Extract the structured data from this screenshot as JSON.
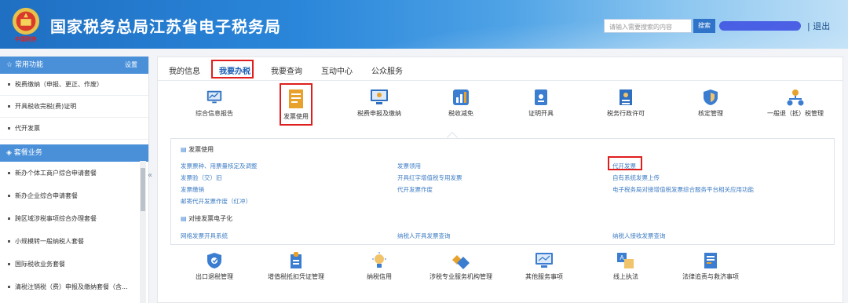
{
  "header": {
    "title": "国家税务总局江苏省电子税务局",
    "emblem_caption": "中国税务",
    "search_placeholder": "请输入需要搜索的内容",
    "search_button": "搜索",
    "logout": "| 退出"
  },
  "sidebar": {
    "common_title": "常用功能",
    "settings": "设置",
    "common_items": [
      "税费缴纳（申报、更正、作废）",
      "开具税收完税(费)证明",
      "代开发票"
    ],
    "package_title": "套餐业务",
    "package_items": [
      "新办个体工商户综合申请套餐",
      "新办企业综合申请套餐",
      "跨区域涉税事项综合办理套餐",
      "小规模转一般纳税人套餐",
      "国际税收业务套餐",
      "清税注销税（费）申报及缴纳套餐（含..."
    ],
    "collapse_icon": "«"
  },
  "tabs": [
    "我的信息",
    "我要办税",
    "我要查询",
    "互动中心",
    "公众服务"
  ],
  "top_icons": [
    {
      "label": "综合信息报告",
      "icon": "monitor-chart-icon"
    },
    {
      "label": "发票使用",
      "icon": "invoice-doc-icon"
    },
    {
      "label": "税费申报及缴纳",
      "icon": "monitor-icon"
    },
    {
      "label": "税收减免",
      "icon": "bar-chart-icon"
    },
    {
      "label": "证明开具",
      "icon": "certificate-icon"
    },
    {
      "label": "税务行政许可",
      "icon": "license-icon"
    },
    {
      "label": "核定管理",
      "icon": "shield-icon"
    },
    {
      "label": "一般退（抵）税管理",
      "icon": "org-chart-icon"
    }
  ],
  "invoice_section": {
    "title": "发票使用",
    "col1": [
      "发票票种、用票量核定及调整",
      "发票验（交）旧",
      "发票缴销",
      "邮寄代开发票作废（红冲）"
    ],
    "col2": [
      "发票领用",
      "开具红字增值税专用发票",
      "代开发票作废"
    ],
    "col3": [
      "代开发票",
      "自有系统发票上传",
      "电子税务局对接增值税发票综合服务平台相关应用功能"
    ]
  },
  "einvoice_section": {
    "title": "对接发票电子化",
    "links": [
      "网络发票开具系统",
      "纳税人开具发票查询",
      "纳税人接收发票查询"
    ]
  },
  "bottom_icons": [
    {
      "label": "出口退税管理",
      "icon": "shield-badge-icon"
    },
    {
      "label": "增值税抵扣凭证管理",
      "icon": "lock-doc-icon"
    },
    {
      "label": "纳税信用",
      "icon": "bulb-icon"
    },
    {
      "label": "涉税专业服务机构管理",
      "icon": "diamond-icon"
    },
    {
      "label": "其他服务事项",
      "icon": "screen-icon"
    },
    {
      "label": "线上执法",
      "icon": "translate-icon"
    },
    {
      "label": "法律追责与救济事项",
      "icon": "document-icon"
    }
  ]
}
